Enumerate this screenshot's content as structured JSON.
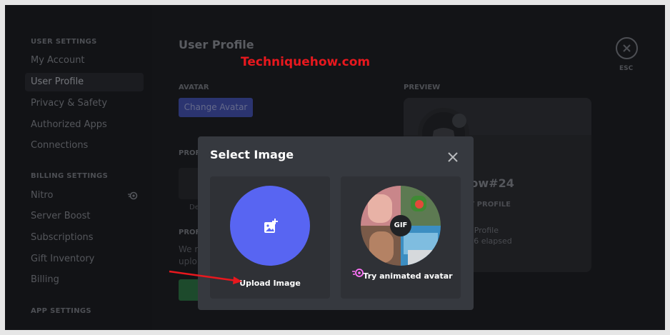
{
  "sidebar": {
    "user_settings_heading": "USER SETTINGS",
    "items": [
      "My Account",
      "User Profile",
      "Privacy & Safety",
      "Authorized Apps",
      "Connections"
    ],
    "billing_heading": "BILLING SETTINGS",
    "billing_items": [
      "Nitro",
      "Server Boost",
      "Subscriptions",
      "Gift Inventory",
      "Billing"
    ],
    "app_heading": "APP SETTINGS"
  },
  "main": {
    "title": "User Profile",
    "watermark": "Techniquehow.com",
    "avatar_label": "AVATAR",
    "change_avatar": "Change Avatar",
    "preview_label": "PREVIEW",
    "profile_label_1": "PROF",
    "profile_label_2": "PROF",
    "ghost_we": "We r",
    "ghost_uplo": "uplo",
    "ghost_de": "De",
    "preview_name": "how#24",
    "preview_my_profile": "MY PROFILE",
    "preview_user_profile": "er Profile",
    "preview_elapsed": ": 56 elapsed",
    "esc": "ESC"
  },
  "modal": {
    "title": "Select Image",
    "upload_label": "Upload Image",
    "animated_label": "Try animated avatar",
    "gif_badge": "GIF"
  },
  "colors": {
    "blurple": "#5865f2",
    "modal_bg": "#36393f",
    "option_bg": "#2f3136",
    "watermark": "#e8181e",
    "nitro": "#ff73fa"
  }
}
